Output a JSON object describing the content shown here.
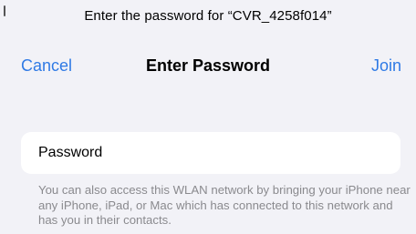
{
  "header": {
    "prompt": "Enter the password for “CVR_4258f014”"
  },
  "navbar": {
    "cancel_label": "Cancel",
    "title": "Enter Password",
    "join_label": "Join"
  },
  "password_field": {
    "placeholder": "Password",
    "value": ""
  },
  "footnote": {
    "text": "You can also access this WLAN network by bringing your iPhone near any iPhone, iPad, or Mac which has connected to this network and has you in their contacts."
  },
  "colors": {
    "accent": "#2f7ae5",
    "background": "#f2f2f7",
    "field_background": "#ffffff",
    "secondary_text": "#8a8a8e"
  }
}
